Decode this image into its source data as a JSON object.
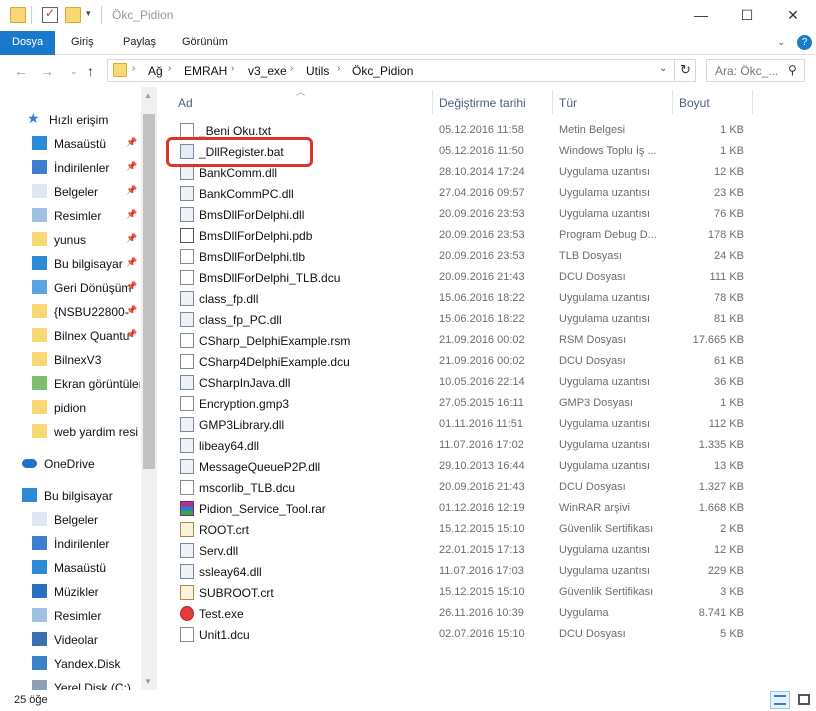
{
  "window": {
    "title": "Ökc_Pidion",
    "minimize": "—",
    "maximize": "☐",
    "close": "✕"
  },
  "ribbon": {
    "tabs": [
      "Dosya",
      "Giriş",
      "Paylaş",
      "Görünüm"
    ],
    "help": "?"
  },
  "address": {
    "crumbs": [
      "Ağ",
      "EMRAH",
      "v3_exe",
      "Utils",
      "Ökc_Pidion"
    ],
    "search_placeholder": "Ara: Ökc_..."
  },
  "sidebar": {
    "items": [
      {
        "label": "Hızlı erişim",
        "icon": "star-icon"
      },
      {
        "label": "Masaüstü",
        "icon": "desktop-icon",
        "pinned": true
      },
      {
        "label": "İndirilenler",
        "icon": "download-icon",
        "pinned": true
      },
      {
        "label": "Belgeler",
        "icon": "documents-icon",
        "pinned": true
      },
      {
        "label": "Resimler",
        "icon": "pictures-icon",
        "pinned": true
      },
      {
        "label": "yunus",
        "icon": "folder-icon",
        "pinned": true
      },
      {
        "label": "Bu bilgisayar",
        "icon": "computer-icon",
        "pinned": true
      },
      {
        "label": "Geri Dönüşüm",
        "icon": "recycle-icon",
        "pinned": true
      },
      {
        "label": "{NSBU22800-",
        "icon": "folder-icon",
        "pinned": true
      },
      {
        "label": "Bilnex Quantu",
        "icon": "folder-icon",
        "pinned": true
      },
      {
        "label": "BilnexV3",
        "icon": "folder-icon"
      },
      {
        "label": "Ekran görüntüleri",
        "icon": "screenshots-icon"
      },
      {
        "label": "pidion",
        "icon": "folder-icon"
      },
      {
        "label": "web yardim resi",
        "icon": "folder-icon"
      },
      {
        "label": "OneDrive",
        "icon": "cloud-icon"
      },
      {
        "label": "Bu bilgisayar",
        "icon": "computer-icon"
      },
      {
        "label": "Belgeler",
        "icon": "documents-icon"
      },
      {
        "label": "İndirilenler",
        "icon": "download-icon"
      },
      {
        "label": "Masaüstü",
        "icon": "desktop-icon"
      },
      {
        "label": "Müzikler",
        "icon": "music-icon"
      },
      {
        "label": "Resimler",
        "icon": "pictures-icon"
      },
      {
        "label": "Videolar",
        "icon": "video-icon"
      },
      {
        "label": "Yandex.Disk",
        "icon": "yandex-icon"
      },
      {
        "label": "Yerel Disk (C:)",
        "icon": "disk-icon"
      }
    ]
  },
  "columns": {
    "name": "Ad",
    "date": "Değiştirme tarihi",
    "type": "Tür",
    "size": "Boyut"
  },
  "files": [
    {
      "name": "_Beni Oku.txt",
      "date": "05.12.2016 11:58",
      "type": "Metin Belgesi",
      "size": "1 KB",
      "icon": "text-file-icon"
    },
    {
      "name": "_DllRegister.bat",
      "date": "05.12.2016 11:50",
      "type": "Windows Toplu İş ...",
      "size": "1 KB",
      "icon": "batch-file-icon"
    },
    {
      "name": "BankComm.dll",
      "date": "28.10.2014 17:24",
      "type": "Uygulama uzantısı",
      "size": "12 KB",
      "icon": "dll-file-icon"
    },
    {
      "name": "BankCommPC.dll",
      "date": "27.04.2016 09:57",
      "type": "Uygulama uzantısı",
      "size": "23 KB",
      "icon": "dll-file-icon"
    },
    {
      "name": "BmsDllForDelphi.dll",
      "date": "20.09.2016 23:53",
      "type": "Uygulama uzantısı",
      "size": "76 KB",
      "icon": "dll-file-icon"
    },
    {
      "name": "BmsDllForDelphi.pdb",
      "date": "20.09.2016 23:53",
      "type": "Program Debug D...",
      "size": "178 KB",
      "icon": "pdb-file-icon"
    },
    {
      "name": "BmsDllForDelphi.tlb",
      "date": "20.09.2016 23:53",
      "type": "TLB Dosyası",
      "size": "24 KB",
      "icon": "generic-file-icon"
    },
    {
      "name": "BmsDllForDelphi_TLB.dcu",
      "date": "20.09.2016 21:43",
      "type": "DCU Dosyası",
      "size": "111 KB",
      "icon": "generic-file-icon"
    },
    {
      "name": "class_fp.dll",
      "date": "15.06.2016 18:22",
      "type": "Uygulama uzantısı",
      "size": "78 KB",
      "icon": "dll-file-icon"
    },
    {
      "name": "class_fp_PC.dll",
      "date": "15.06.2016 18:22",
      "type": "Uygulama uzantısı",
      "size": "81 KB",
      "icon": "dll-file-icon"
    },
    {
      "name": "CSharp_DelphiExample.rsm",
      "date": "21.09.2016 00:02",
      "type": "RSM Dosyası",
      "size": "17.665 KB",
      "icon": "generic-file-icon"
    },
    {
      "name": "CSharp4DelphiExample.dcu",
      "date": "21.09.2016 00:02",
      "type": "DCU Dosyası",
      "size": "61 KB",
      "icon": "generic-file-icon"
    },
    {
      "name": "CSharpInJava.dll",
      "date": "10.05.2016 22:14",
      "type": "Uygulama uzantısı",
      "size": "36 KB",
      "icon": "dll-file-icon"
    },
    {
      "name": "Encryption.gmp3",
      "date": "27.05.2015 16:11",
      "type": "GMP3 Dosyası",
      "size": "1 KB",
      "icon": "generic-file-icon"
    },
    {
      "name": "GMP3Library.dll",
      "date": "01.11.2016 11:51",
      "type": "Uygulama uzantısı",
      "size": "112 KB",
      "icon": "dll-file-icon"
    },
    {
      "name": "libeay64.dll",
      "date": "11.07.2016 17:02",
      "type": "Uygulama uzantısı",
      "size": "1.335 KB",
      "icon": "dll-file-icon"
    },
    {
      "name": "MessageQueueP2P.dll",
      "date": "29.10.2013 16:44",
      "type": "Uygulama uzantısı",
      "size": "13 KB",
      "icon": "dll-file-icon"
    },
    {
      "name": "mscorlib_TLB.dcu",
      "date": "20.09.2016 21:43",
      "type": "DCU Dosyası",
      "size": "1.327 KB",
      "icon": "generic-file-icon"
    },
    {
      "name": "Pidion_Service_Tool.rar",
      "date": "01.12.2016 12:19",
      "type": "WinRAR arşivi",
      "size": "1.668 KB",
      "icon": "rar-file-icon"
    },
    {
      "name": "ROOT.crt",
      "date": "15.12.2015 15:10",
      "type": "Güvenlik Sertifikası",
      "size": "2 KB",
      "icon": "certificate-icon"
    },
    {
      "name": "Serv.dll",
      "date": "22.01.2015 17:13",
      "type": "Uygulama uzantısı",
      "size": "12 KB",
      "icon": "dll-file-icon"
    },
    {
      "name": "ssleay64.dll",
      "date": "11.07.2016 17:03",
      "type": "Uygulama uzantısı",
      "size": "229 KB",
      "icon": "dll-file-icon"
    },
    {
      "name": "SUBROOT.crt",
      "date": "15.12.2015 15:10",
      "type": "Güvenlik Sertifikası",
      "size": "3 KB",
      "icon": "certificate-icon"
    },
    {
      "name": "Test.exe",
      "date": "26.11.2016 10:39",
      "type": "Uygulama",
      "size": "8.741 KB",
      "icon": "exe-file-icon"
    },
    {
      "name": "Unit1.dcu",
      "date": "02.07.2016 15:10",
      "type": "DCU Dosyası",
      "size": "5 KB",
      "icon": "generic-file-icon"
    }
  ],
  "status": {
    "item_count": "25 öğe"
  },
  "colors": {
    "accent": "#1979ca",
    "highlight": "#d9352b",
    "folder": "#f8d775"
  }
}
